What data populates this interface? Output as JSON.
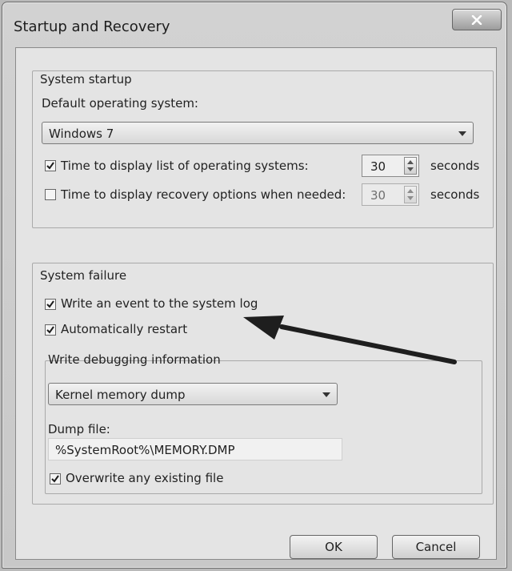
{
  "window": {
    "title": "Startup and Recovery"
  },
  "system_startup": {
    "group_label": "System startup",
    "default_os_label": "Default operating system:",
    "default_os_value": "Windows 7",
    "time_list_label": "Time to display list of operating systems:",
    "time_list_value": "30",
    "time_list_unit": "seconds",
    "time_list_checked": true,
    "time_recovery_label": "Time to display recovery options when needed:",
    "time_recovery_value": "30",
    "time_recovery_unit": "seconds",
    "time_recovery_checked": false
  },
  "system_failure": {
    "group_label": "System failure",
    "write_event_label": "Write an event to the system log",
    "write_event_checked": true,
    "auto_restart_label": "Automatically restart",
    "auto_restart_checked": true,
    "debug_info_label": "Write debugging information",
    "debug_info_value": "Kernel memory dump",
    "dump_file_label": "Dump file:",
    "dump_file_value": "%SystemRoot%\\MEMORY.DMP",
    "overwrite_label": "Overwrite any existing file",
    "overwrite_checked": true
  },
  "buttons": {
    "ok": "OK",
    "cancel": "Cancel"
  },
  "colors": {
    "window_bg": "#c8c8c8",
    "annotation_arrow": "#1e1e1e"
  }
}
